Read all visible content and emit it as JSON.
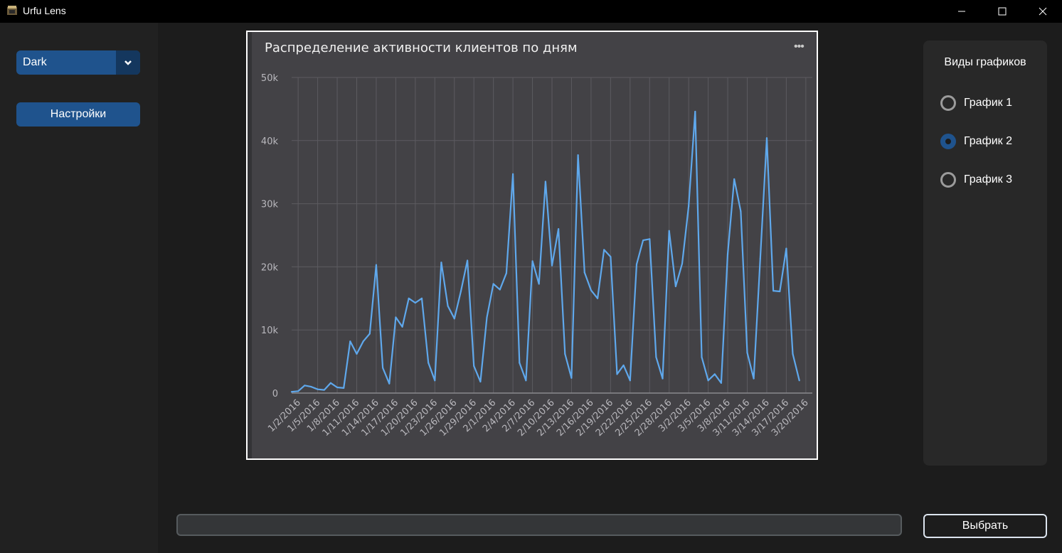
{
  "window": {
    "title": "Urfu Lens",
    "minimize_icon": "minimize-icon",
    "maximize_icon": "maximize-icon",
    "close_icon": "close-icon"
  },
  "sidebar": {
    "theme_value": "Dark",
    "settings_label": "Настройки"
  },
  "chart_panel": {
    "title": "Распределение активности клиентов по дням",
    "menu_icon": "more-icon"
  },
  "chart_data": {
    "type": "line",
    "title": "Распределение активности клиентов по дням",
    "xlabel": "",
    "ylabel": "",
    "ylim": [
      0,
      50000
    ],
    "yticks": [
      0,
      10000,
      20000,
      30000,
      40000,
      50000
    ],
    "ytick_labels": [
      "0",
      "10k",
      "20k",
      "30k",
      "40k",
      "50k"
    ],
    "grid": true,
    "line_color": "#5fa8ec",
    "x": [
      "1/1/2016",
      "1/2/2016",
      "1/3/2016",
      "1/4/2016",
      "1/5/2016",
      "1/6/2016",
      "1/7/2016",
      "1/8/2016",
      "1/9/2016",
      "1/10/2016",
      "1/11/2016",
      "1/12/2016",
      "1/13/2016",
      "1/14/2016",
      "1/15/2016",
      "1/16/2016",
      "1/17/2016",
      "1/18/2016",
      "1/19/2016",
      "1/20/2016",
      "1/21/2016",
      "1/22/2016",
      "1/23/2016",
      "1/24/2016",
      "1/25/2016",
      "1/26/2016",
      "1/27/2016",
      "1/28/2016",
      "1/29/2016",
      "1/30/2016",
      "1/31/2016",
      "2/1/2016",
      "2/2/2016",
      "2/3/2016",
      "2/4/2016",
      "2/5/2016",
      "2/6/2016",
      "2/7/2016",
      "2/8/2016",
      "2/9/2016",
      "2/10/2016",
      "2/11/2016",
      "2/12/2016",
      "2/13/2016",
      "2/14/2016",
      "2/15/2016",
      "2/16/2016",
      "2/17/2016",
      "2/18/2016",
      "2/19/2016",
      "2/20/2016",
      "2/21/2016",
      "2/22/2016",
      "2/23/2016",
      "2/24/2016",
      "2/25/2016",
      "2/26/2016",
      "2/27/2016",
      "2/28/2016",
      "2/29/2016",
      "3/1/2016",
      "3/2/2016",
      "3/3/2016",
      "3/4/2016",
      "3/5/2016",
      "3/6/2016",
      "3/7/2016",
      "3/8/2016",
      "3/9/2016",
      "3/10/2016",
      "3/11/2016",
      "3/12/2016",
      "3/13/2016",
      "3/14/2016",
      "3/15/2016",
      "3/16/2016",
      "3/17/2016",
      "3/18/2016",
      "3/19/2016",
      "3/20/2016",
      "3/21/2016"
    ],
    "tick_labels": [
      "1/2/2016",
      "1/5/2016",
      "1/8/2016",
      "1/11/2016",
      "1/14/2016",
      "1/17/2016",
      "1/20/2016",
      "1/23/2016",
      "1/26/2016",
      "1/29/2016",
      "2/1/2016",
      "2/4/2016",
      "2/7/2016",
      "2/10/2016",
      "2/13/2016",
      "2/16/2016",
      "2/19/2016",
      "2/22/2016",
      "2/25/2016",
      "2/28/2016",
      "3/2/2016",
      "3/5/2016",
      "3/8/2016",
      "3/11/2016",
      "3/14/2016",
      "3/17/2016",
      "3/20/2016"
    ],
    "values": [
      200,
      300,
      1200,
      1000,
      600,
      500,
      1600,
      900,
      800,
      8200,
      6200,
      8200,
      9400,
      20300,
      4000,
      1500,
      12000,
      10500,
      15000,
      14300,
      15000,
      4800,
      2000,
      20700,
      13800,
      11800,
      16100,
      21000,
      4300,
      1800,
      12000,
      17300,
      16400,
      19000,
      34700,
      4800,
      2000,
      20900,
      17300,
      33500,
      20200,
      26000,
      6200,
      2400,
      37700,
      19100,
      16300,
      15000,
      22700,
      21600,
      3000,
      4400,
      2000,
      20400,
      24200,
      24400,
      5700,
      2300,
      25700,
      16900,
      20500,
      29600,
      44600,
      5700,
      2000,
      3000,
      1600,
      22000,
      33900,
      28800,
      6400,
      2300,
      21300,
      40400,
      16200,
      16100,
      22900,
      6200,
      2000
    ]
  },
  "right_panel": {
    "title": "Виды графиков",
    "options": [
      {
        "label": "График 1",
        "selected": false
      },
      {
        "label": "График 2",
        "selected": true
      },
      {
        "label": "График 3",
        "selected": false
      }
    ]
  },
  "footer": {
    "path_value": "",
    "select_label": "Выбрать"
  },
  "colors": {
    "accent": "#1f538d",
    "accent_dark": "#14375e",
    "chart_bg": "#434246",
    "line": "#5fa8ec"
  }
}
